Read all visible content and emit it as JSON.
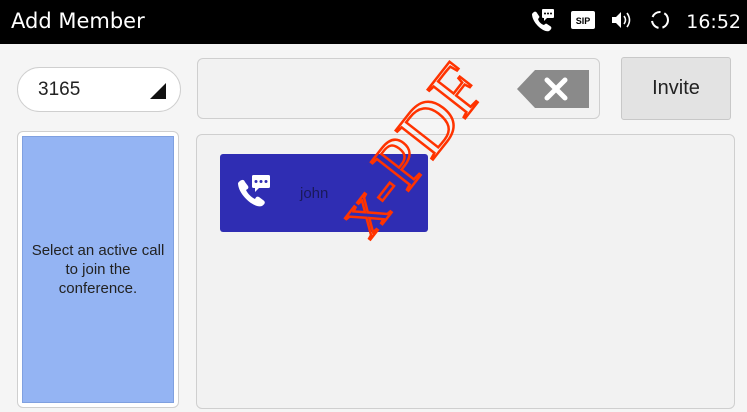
{
  "statusbar": {
    "title": "Add Member",
    "time": "16:52",
    "icons": [
      "call-message-icon",
      "sip-badge-icon",
      "volume-icon",
      "sync-icon"
    ],
    "sip_label": "SIP"
  },
  "toolbar": {
    "account_value": "3165",
    "input_value": "",
    "invite_label": "Invite"
  },
  "hint": {
    "text": "Select an active call to join the conference."
  },
  "contacts": [
    {
      "name": "john",
      "icon": "call-message-icon"
    }
  ],
  "watermark": {
    "text": "x-PDF"
  },
  "colors": {
    "status_bg": "#000000",
    "hint_bg": "#94b4f3",
    "card_bg": "#2f2db3",
    "watermark": "#ff3300",
    "backspace_bg": "#8a8a8a"
  }
}
